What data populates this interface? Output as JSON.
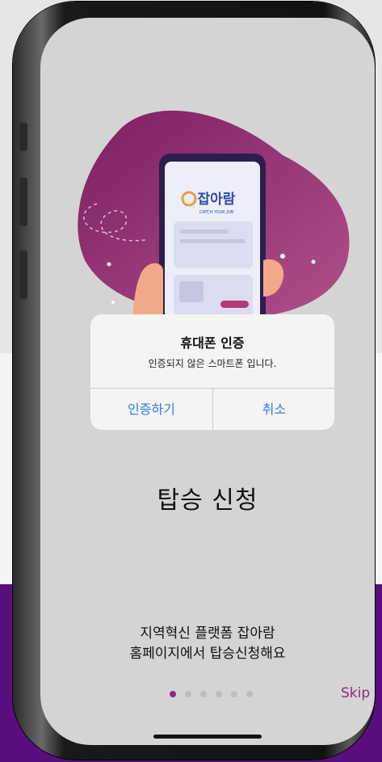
{
  "dialog": {
    "title": "휴대폰 인증",
    "message": "인증되지 않은 스마트폰 입니다.",
    "confirm_label": "인증하기",
    "cancel_label": "취소"
  },
  "onboarding": {
    "title": "탑승 신청",
    "line1": "지역혁신 플랫폼 잡아람",
    "line2": "홈페이지에서 탑승신청해요",
    "skip_label": "Skip",
    "page_count": 6,
    "current_page": 1
  },
  "logo": {
    "name": "잡아람",
    "tagline": "CATCH YOUR JOB"
  },
  "colors": {
    "accent": "#8b2a7f",
    "dialog_button": "#2f7de1",
    "blob": "#9b3a75",
    "background_purple": "#5a0f7e"
  }
}
